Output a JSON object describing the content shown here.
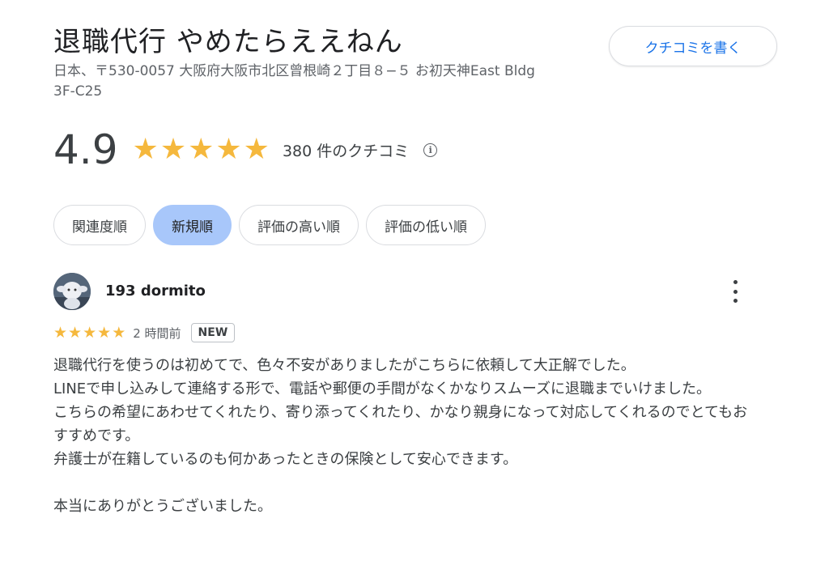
{
  "place": {
    "name": "退職代行 やめたらええねん",
    "address_line1": "日本、〒530-0057 大阪府大阪市北区曾根崎２丁目８−５ お初天神East Bldg",
    "address_line2": "3F-C25",
    "write_review_label": "クチコミを書く"
  },
  "rating": {
    "score": "4.9",
    "stars": "★★★★★",
    "review_count": "380 件のクチコミ",
    "info_glyph": "i"
  },
  "sort_chips": [
    {
      "label": "関連度順",
      "active": false
    },
    {
      "label": "新規順",
      "active": true
    },
    {
      "label": "評価の高い順",
      "active": false
    },
    {
      "label": "評価の低い順",
      "active": false
    }
  ],
  "review": {
    "reviewer_name": "193 dormito",
    "stars": "★★★★★",
    "time": "2 時間前",
    "badge": "NEW",
    "body_lines": [
      "退職代行を使うのは初めてで、色々不安がありましたがこちらに依頼して大正解でした。",
      "LINEで申し込みして連絡する形で、電話や郵便の手間がなくかなりスムーズに退職までいけました。",
      "こちらの希望にあわせてくれたり、寄り添ってくれたり、かなり親身になって対応してくれるのでとてもおすすめです。",
      "弁護士が在籍しているのも何かあったときの保険として安心できます。",
      "",
      "本当にありがとうございました。"
    ]
  },
  "colors": {
    "star": "#f5b83d",
    "link_blue": "#1a73e8",
    "chip_active": "#a8c7fa"
  }
}
